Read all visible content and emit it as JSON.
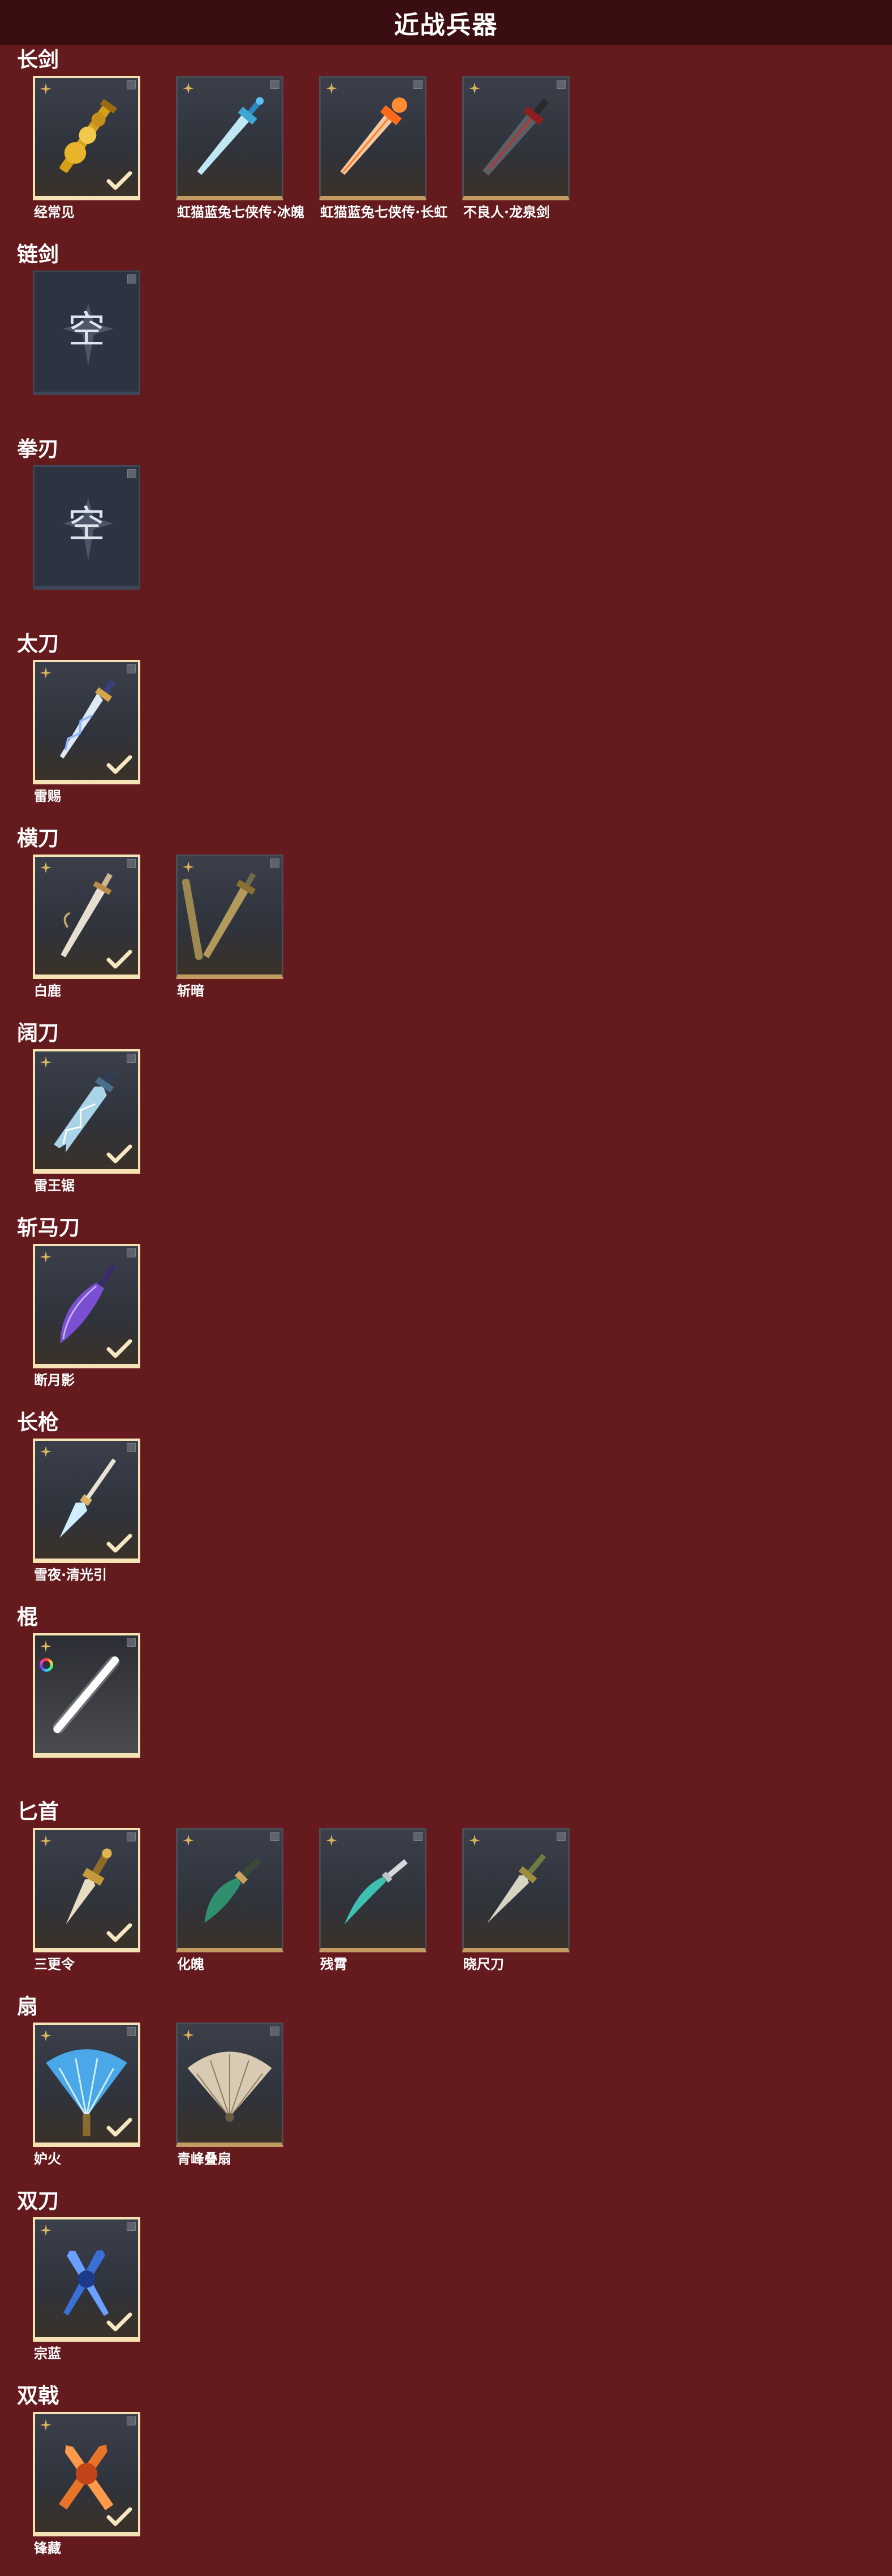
{
  "header": {
    "title": "近战兵器"
  },
  "categories": [
    {
      "key": "changjian",
      "title": "长剑",
      "items": [
        {
          "name": "经常见",
          "state": "equipped",
          "weapon": "golden-sword-icon"
        },
        {
          "name": "虹猫蓝兔七侠传·冰魄",
          "state": "normal",
          "weapon": "ice-sword-icon"
        },
        {
          "name": "虹猫蓝兔七侠传·长虹",
          "state": "normal",
          "weapon": "fire-sword-icon"
        },
        {
          "name": "不良人·龙泉剑",
          "state": "normal",
          "weapon": "dark-sword-icon"
        }
      ]
    },
    {
      "key": "lianjian",
      "title": "链剑",
      "items": [
        {
          "name": "",
          "state": "empty",
          "empty_label": "空"
        }
      ]
    },
    {
      "key": "quandao",
      "title": "拳刃",
      "items": [
        {
          "name": "",
          "state": "empty",
          "empty_label": "空"
        }
      ]
    },
    {
      "key": "taidao",
      "title": "太刀",
      "items": [
        {
          "name": "雷赐",
          "state": "equipped",
          "weapon": "lightning-katana-icon"
        }
      ]
    },
    {
      "key": "hengdao",
      "title": "横刀",
      "items": [
        {
          "name": "白鹿",
          "state": "equipped",
          "weapon": "white-deer-blade-icon"
        },
        {
          "name": "斩暗",
          "state": "normal",
          "weapon": "bronze-blade-icon"
        }
      ]
    },
    {
      "key": "kuodao",
      "title": "阔刀",
      "items": [
        {
          "name": "雷王锯",
          "state": "equipped",
          "weapon": "thunder-saw-blade-icon"
        }
      ]
    },
    {
      "key": "zhanmadao",
      "title": "斩马刀",
      "items": [
        {
          "name": "断月影",
          "state": "equipped",
          "weapon": "purple-glaive-icon"
        }
      ]
    },
    {
      "key": "changqiang",
      "title": "长枪",
      "items": [
        {
          "name": "雪夜·清光引",
          "state": "equipped",
          "weapon": "ice-spear-icon"
        }
      ]
    },
    {
      "key": "gun",
      "title": "棍",
      "items": [
        {
          "name": "",
          "state": "equipped-rgb",
          "weapon": "glowing-staff-icon"
        }
      ]
    },
    {
      "key": "bishou",
      "title": "匕首",
      "items": [
        {
          "name": "三更令",
          "state": "equipped",
          "weapon": "golden-dagger-icon"
        },
        {
          "name": "化魄",
          "state": "normal",
          "weapon": "jade-dagger-icon"
        },
        {
          "name": "残霄",
          "state": "normal",
          "weapon": "curved-dagger-icon"
        },
        {
          "name": "晓尺刀",
          "state": "normal",
          "weapon": "silver-dagger-icon"
        }
      ]
    },
    {
      "key": "shan",
      "title": "扇",
      "items": [
        {
          "name": "妒火",
          "state": "equipped",
          "weapon": "blue-feather-fan-icon"
        },
        {
          "name": "青峰叠扇",
          "state": "normal",
          "weapon": "folding-fan-icon"
        }
      ]
    },
    {
      "key": "shuangdao",
      "title": "双刀",
      "items": [
        {
          "name": "宗蓝",
          "state": "equipped",
          "weapon": "blue-twin-blades-icon"
        }
      ]
    },
    {
      "key": "shuangji",
      "title": "双戟",
      "items": [
        {
          "name": "锋藏",
          "state": "equipped",
          "weapon": "fire-twin-halberd-icon"
        }
      ]
    }
  ],
  "colors": {
    "page_background": "#651a1e",
    "header_background": "#3a0d10",
    "equipped_border": "#f5e3b5",
    "rarity_bar": "#c49a63"
  }
}
